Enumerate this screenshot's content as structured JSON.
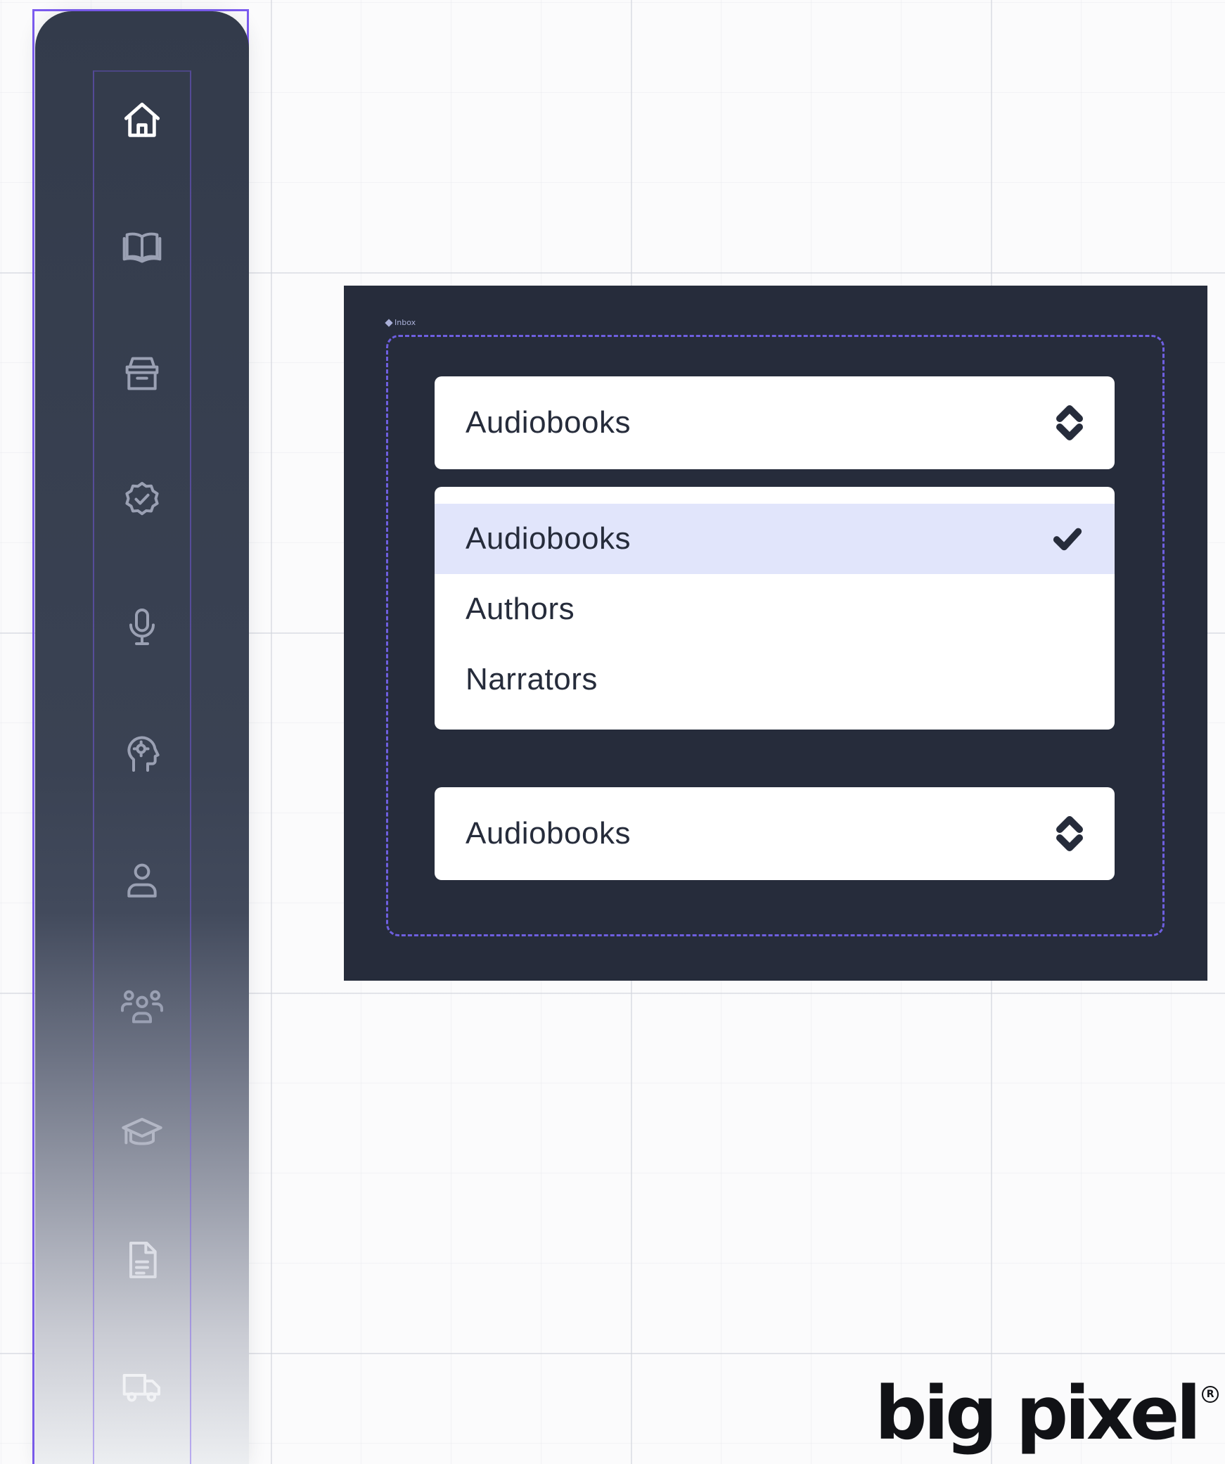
{
  "sidebar": {
    "items": [
      {
        "icon": "home-icon"
      },
      {
        "icon": "book-icon"
      },
      {
        "icon": "store-icon"
      },
      {
        "icon": "badge-check-icon"
      },
      {
        "icon": "microphone-icon"
      },
      {
        "icon": "head-idea-icon"
      },
      {
        "icon": "user-icon"
      },
      {
        "icon": "users-group-icon"
      },
      {
        "icon": "graduation-cap-icon"
      },
      {
        "icon": "document-icon"
      },
      {
        "icon": "delivery-truck-icon"
      }
    ]
  },
  "panel": {
    "tag_label": "Inbox",
    "top_select": {
      "value": "Audiobooks",
      "icon": "chevron-up-down-icon"
    },
    "dropdown": {
      "options": [
        {
          "label": "Audiobooks",
          "selected": true
        },
        {
          "label": "Authors",
          "selected": false
        },
        {
          "label": "Narrators",
          "selected": false
        }
      ],
      "check_icon": "check-icon"
    },
    "bottom_select": {
      "value": "Audiobooks",
      "icon": "chevron-up-down-icon"
    }
  },
  "logo": {
    "text": "big pixel",
    "registered": "R"
  },
  "colors": {
    "sidebar_bg": "#333b4b",
    "panel_bg": "#262c3b",
    "selection_outline": "#7c5cf0",
    "selected_option_bg": "#e1e5fb",
    "text_dark": "#262c3b"
  }
}
